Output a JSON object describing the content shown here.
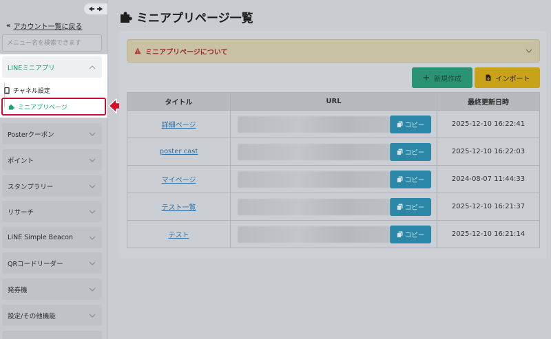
{
  "sidebar": {
    "back_link": "アカウント一覧に戻る",
    "search_placeholder": "メニュー名を検索できます",
    "active_group": {
      "label": "LINEミニアプリ",
      "items": [
        {
          "label": "チャネル設定",
          "icon": "mobile-icon"
        },
        {
          "label": "ミニアプリページ",
          "icon": "puzzle-icon",
          "active": true
        }
      ]
    },
    "groups": [
      {
        "label": "Posterクーポン"
      },
      {
        "label": "ポイント"
      },
      {
        "label": "スタンプラリー"
      },
      {
        "label": "リサーチ"
      },
      {
        "label": "LINE Simple Beacon"
      },
      {
        "label": "QRコードリーダー"
      },
      {
        "label": "発券機"
      },
      {
        "label": "設定/その他機能"
      }
    ]
  },
  "page": {
    "title": "ミニアプリページ一覧",
    "notice": "ミニアプリページについて",
    "buttons": {
      "new": "新規作成",
      "import": "インポート"
    },
    "table": {
      "headers": [
        "タイトル",
        "URL",
        "最終更新日時"
      ],
      "copy_label": "コピー",
      "rows": [
        {
          "title": "詳細ページ",
          "updated": "2025-12-10 16:22:41"
        },
        {
          "title": "poster cast",
          "updated": "2025-12-10 16:22:03"
        },
        {
          "title": "マイページ",
          "updated": "2024-08-07 11:44:33"
        },
        {
          "title": "テスト一覧",
          "updated": "2025-12-10 16:21:37"
        },
        {
          "title": "テスト",
          "updated": "2025-12-10 16:21:14"
        }
      ]
    }
  },
  "colors": {
    "accent_green": "#17a673",
    "highlight_red": "#c8102e",
    "copy_blue": "#2a87a8",
    "import_yellow": "#c9a21a",
    "new_green": "#2a9373"
  }
}
